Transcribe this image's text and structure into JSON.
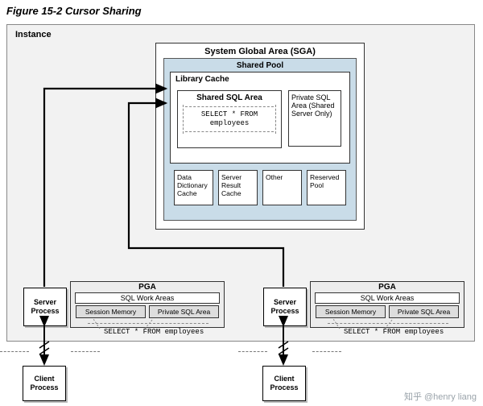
{
  "title": "Figure 15-2 Cursor Sharing",
  "instance_label": "Instance",
  "sga": {
    "title": "System Global Area (SGA)",
    "shared_pool": {
      "title": "Shared Pool",
      "library_cache": {
        "title": "Library Cache",
        "shared_sql_area": {
          "title": "Shared SQL Area",
          "sql": "SELECT * FROM employees"
        },
        "private_sql_area": "Private SQL Area (Shared Server Only)"
      },
      "row2": {
        "data_dict": "Data Dictionary Cache",
        "result": "Server Result Cache",
        "other": "Other",
        "reserved": "Reserved Pool"
      }
    }
  },
  "server_process": "Server Process",
  "pga": {
    "title": "PGA",
    "sql_work": "SQL Work Areas",
    "session_memory": "Session Memory",
    "private_sql": "Private SQL Area"
  },
  "sql_legend": "SELECT * FROM employees",
  "client_process": "Client Process",
  "watermark": "知乎 @henry liang"
}
